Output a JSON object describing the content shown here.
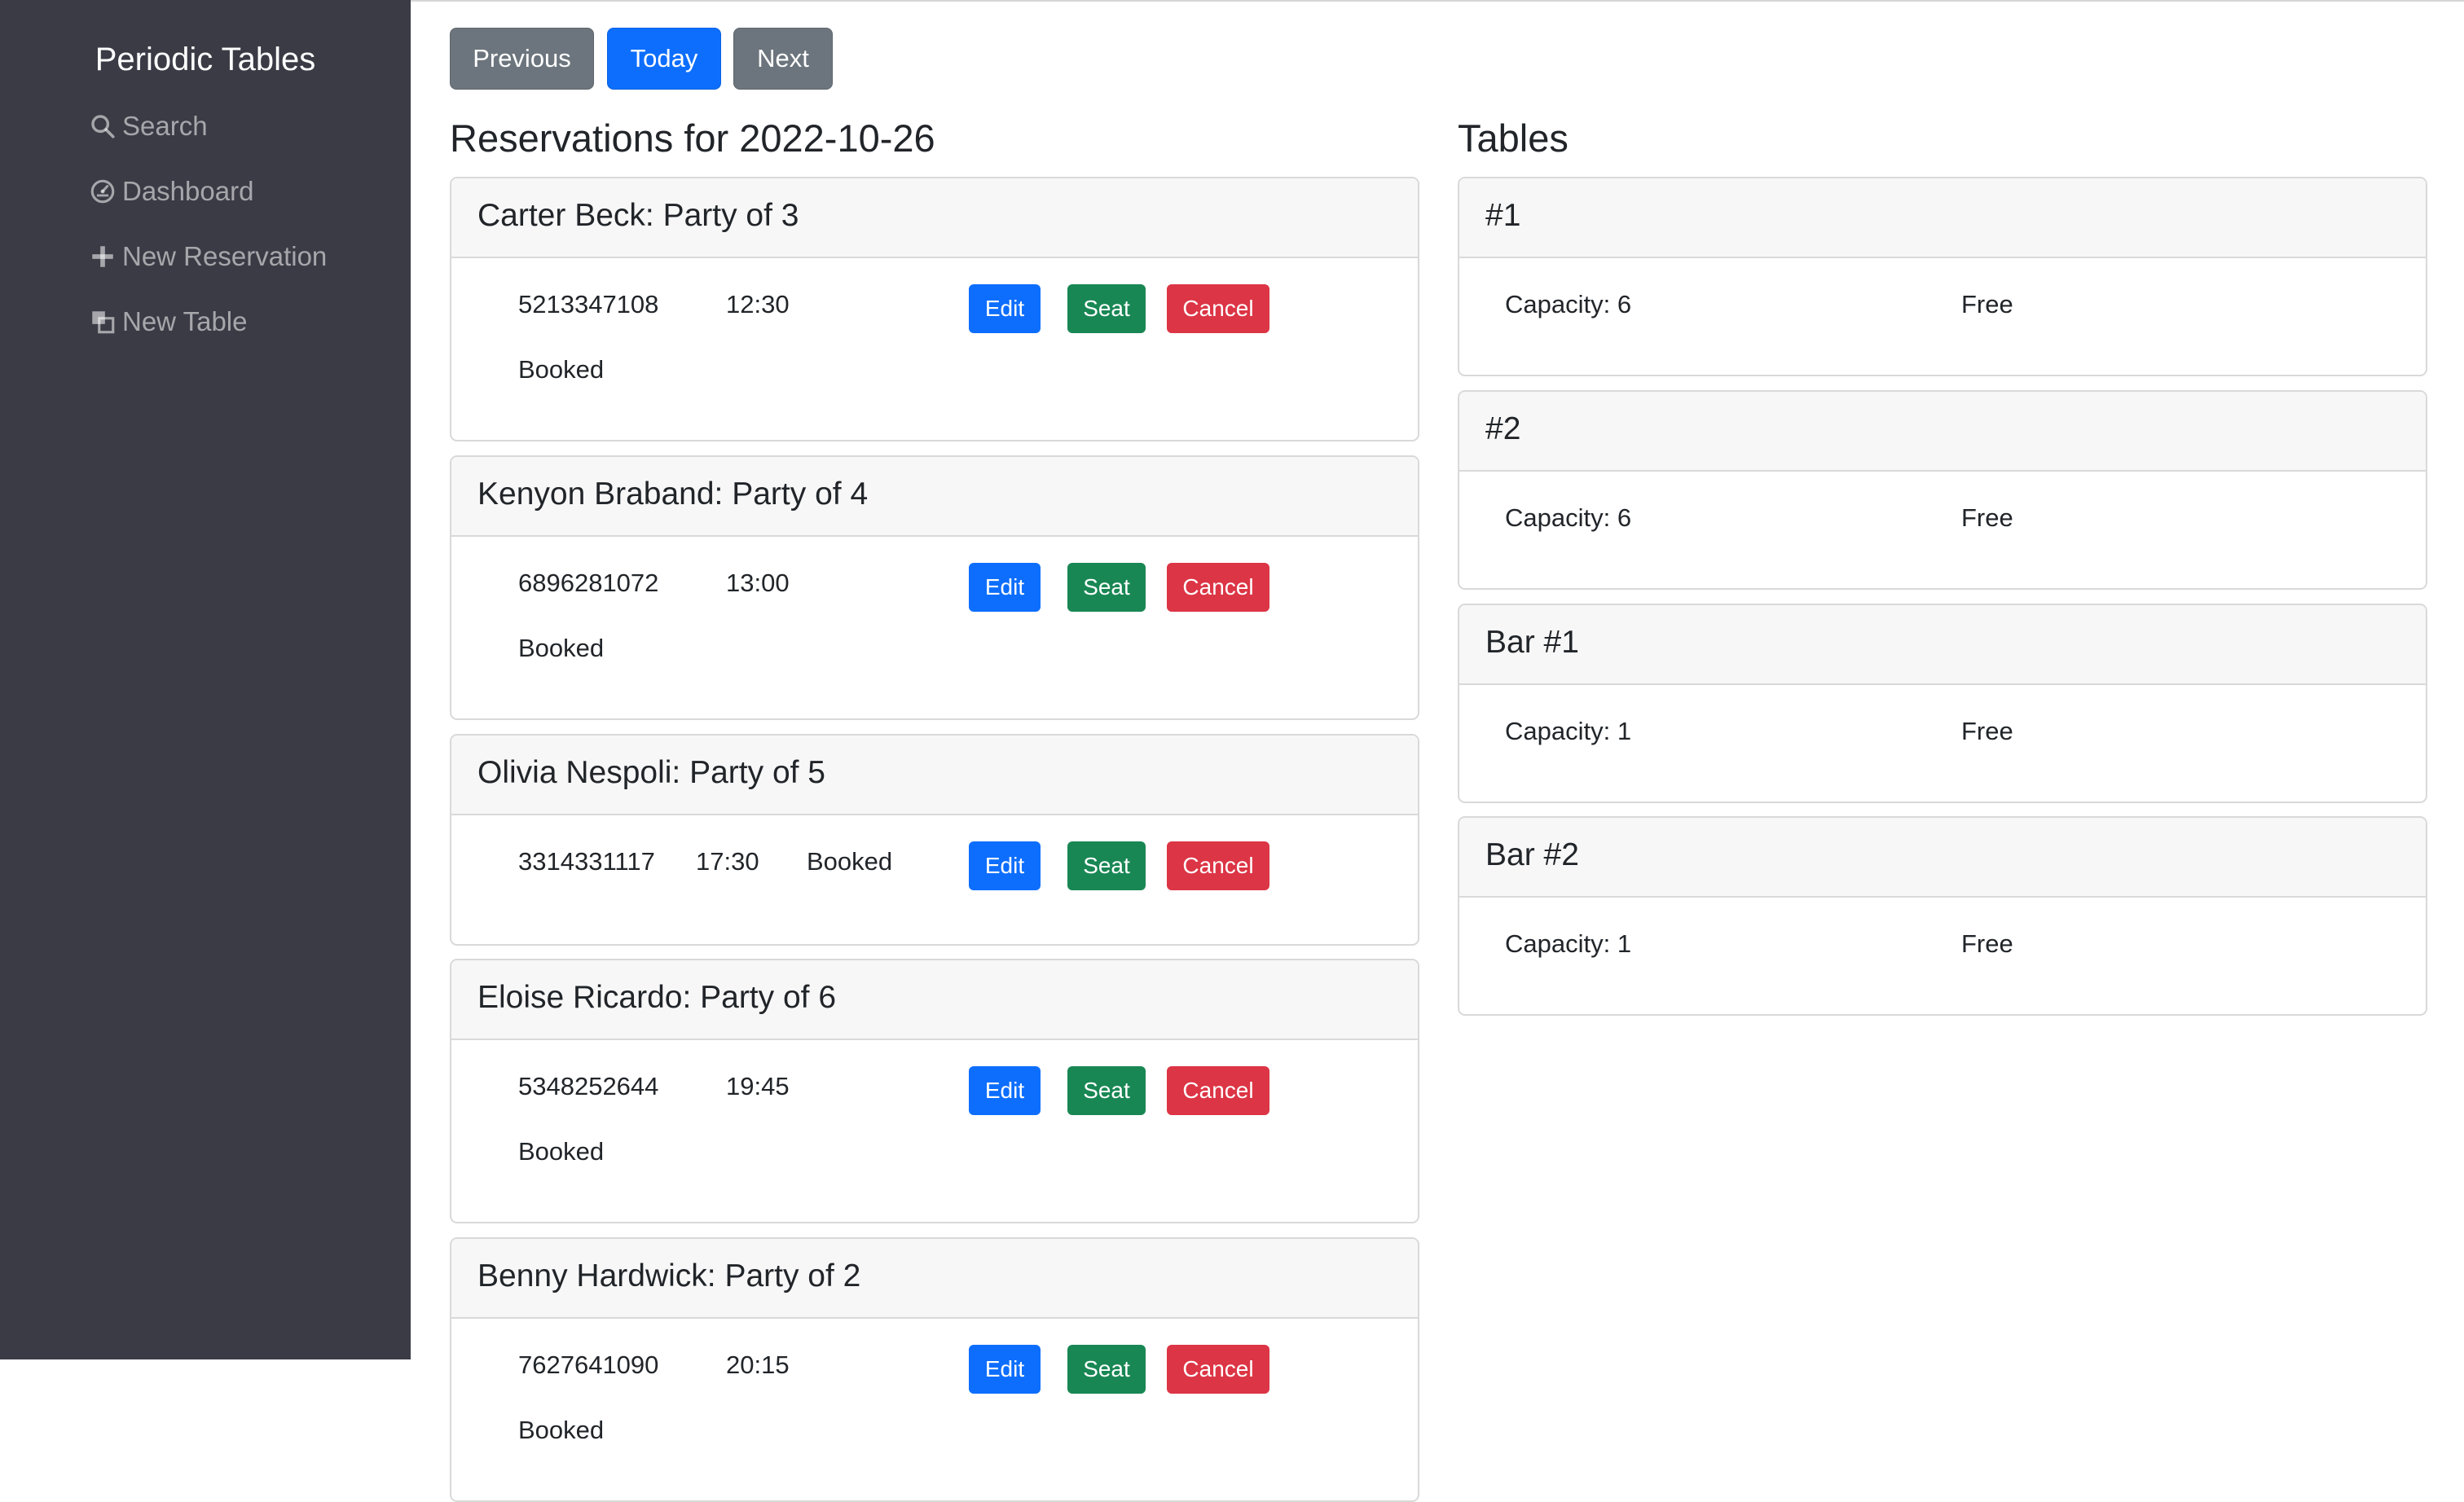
{
  "sidebar": {
    "brand": "Periodic Tables",
    "items": [
      {
        "label": "Search",
        "icon": "search-icon"
      },
      {
        "label": "Dashboard",
        "icon": "dashboard-icon"
      },
      {
        "label": "New Reservation",
        "icon": "plus-icon"
      },
      {
        "label": "New Table",
        "icon": "table-icon"
      }
    ]
  },
  "nav": {
    "previous": "Previous",
    "today": "Today",
    "next": "Next"
  },
  "reservations": {
    "title": "Reservations for 2022-10-26",
    "items": [
      {
        "title": "Carter Beck: Party of 3",
        "phone": "5213347108",
        "time": "12:30",
        "status": "Booked"
      },
      {
        "title": "Kenyon Braband: Party of 4",
        "phone": "6896281072",
        "time": "13:00",
        "status": "Booked"
      },
      {
        "title": "Olivia Nespoli: Party of 5",
        "phone": "3314331117",
        "time": "17:30",
        "status": "Booked"
      },
      {
        "title": "Eloise Ricardo: Party of 6",
        "phone": "5348252644",
        "time": "19:45",
        "status": "Booked"
      },
      {
        "title": "Benny Hardwick: Party of 2",
        "phone": "7627641090",
        "time": "20:15",
        "status": "Booked"
      }
    ],
    "edit_label": "Edit",
    "seat_label": "Seat",
    "cancel_label": "Cancel"
  },
  "tables": {
    "title": "Tables",
    "items": [
      {
        "name": "#1",
        "capacity": "Capacity: 6",
        "status": "Free"
      },
      {
        "name": "#2",
        "capacity": "Capacity: 6",
        "status": "Free"
      },
      {
        "name": "Bar #1",
        "capacity": "Capacity: 1",
        "status": "Free"
      },
      {
        "name": "Bar #2",
        "capacity": "Capacity: 1",
        "status": "Free"
      }
    ]
  },
  "colors": {
    "sidebar_bg": "#3a3b45",
    "primary": "#0d6efd",
    "secondary": "#6c757d",
    "success": "#198754",
    "danger": "#dc3545"
  }
}
